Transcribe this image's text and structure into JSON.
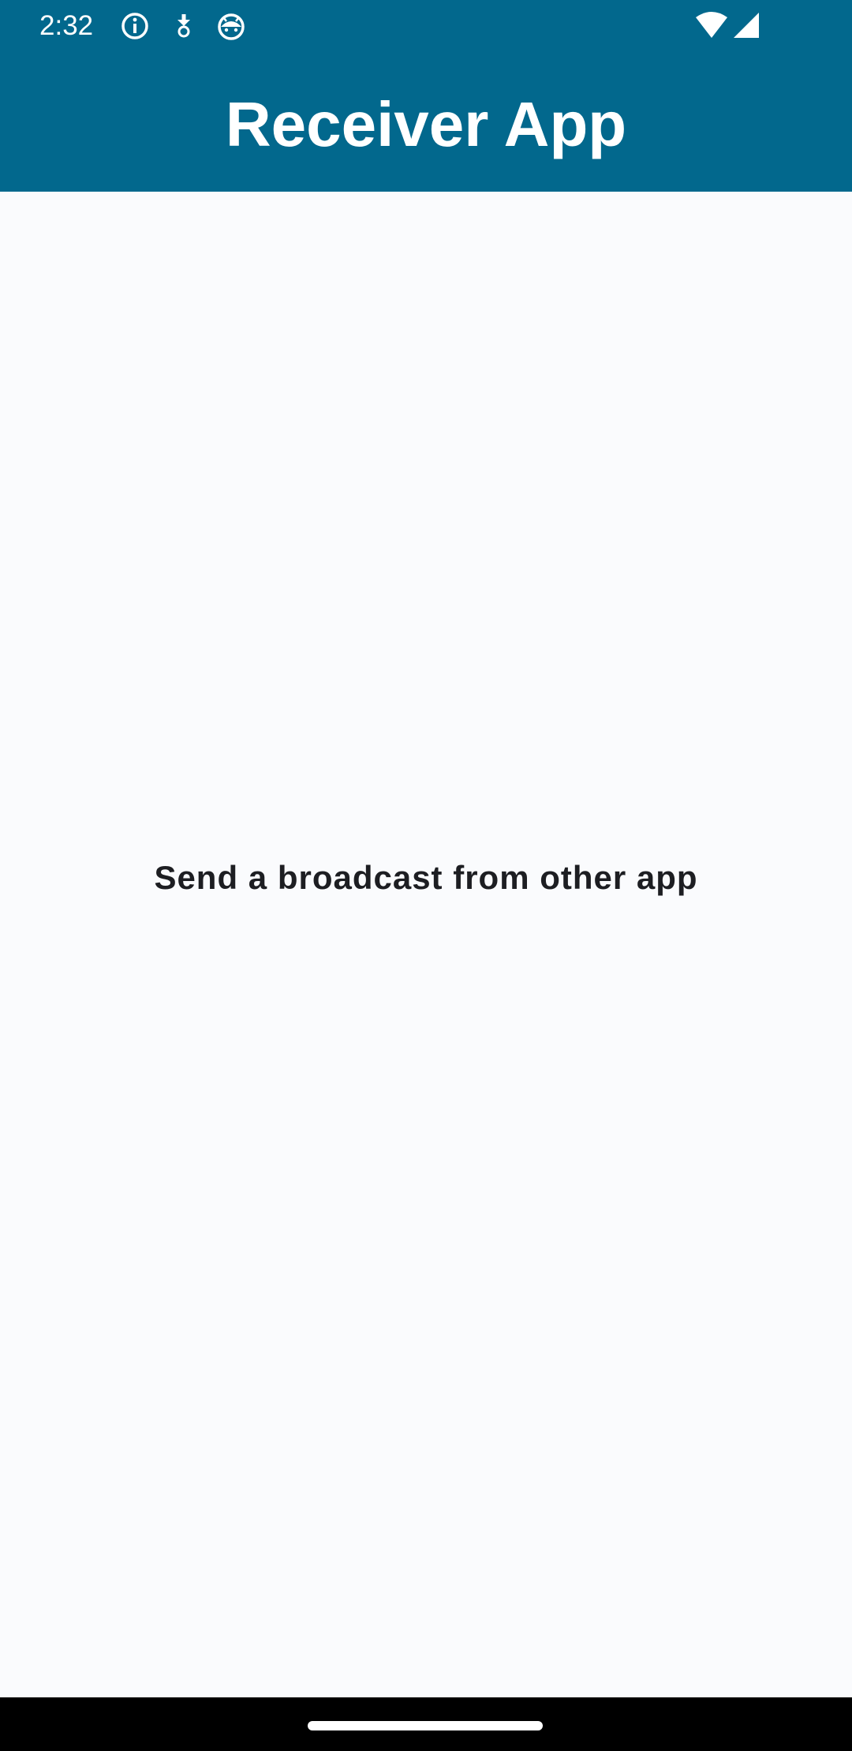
{
  "status_bar": {
    "time": "2:32",
    "icons_left": [
      "info-icon",
      "download-icon",
      "android-face-icon"
    ],
    "icons_right": [
      "wifi-icon",
      "signal-icon"
    ]
  },
  "app_bar": {
    "title": "Receiver App",
    "background_color": "#02688d",
    "text_color": "#ffffff"
  },
  "main": {
    "message": "Send a broadcast from other app",
    "background_color": "#fafbfd"
  },
  "navigation": {
    "handle": "home-gesture-handle"
  }
}
